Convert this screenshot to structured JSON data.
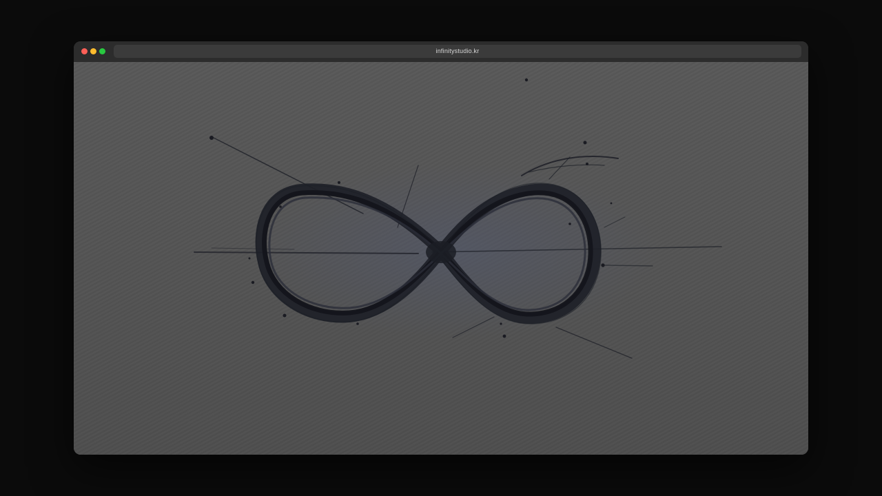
{
  "browser": {
    "url": "infinitystudio.kr",
    "traffic_lights": {
      "close_color": "#fe5f57",
      "minimize_color": "#febc2e",
      "zoom_color": "#28c840"
    }
  },
  "page": {
    "artwork_icon": "infinity-symbol-icon",
    "ink_color": "#1d1f27",
    "paper_color": "#555555"
  }
}
